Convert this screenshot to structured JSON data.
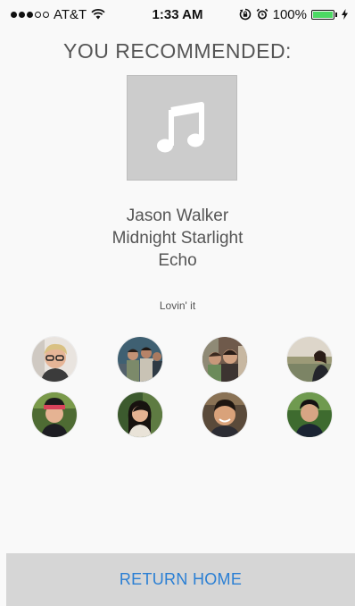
{
  "status_bar": {
    "carrier": "AT&T",
    "time": "1:33 AM",
    "battery_percent": "100%",
    "battery_level": 1.0,
    "signal_bars_filled": 3,
    "signal_bars_total": 5,
    "icons": [
      "wifi-icon",
      "rotation-lock-icon",
      "alarm-icon",
      "battery-icon",
      "charging-bolt-icon"
    ]
  },
  "header": {
    "title": "YOU RECOMMENDED:"
  },
  "album": {
    "icon": "music-note-icon"
  },
  "track": {
    "artist": "Jason Walker",
    "title": "Midnight Starlight",
    "album": "Echo"
  },
  "caption": "Lovin' it",
  "friends": [
    {
      "name": "friend-1"
    },
    {
      "name": "friend-2"
    },
    {
      "name": "friend-3"
    },
    {
      "name": "friend-4"
    },
    {
      "name": "friend-5"
    },
    {
      "name": "friend-6"
    },
    {
      "name": "friend-7"
    },
    {
      "name": "friend-8"
    }
  ],
  "footer": {
    "return_home_label": "RETURN HOME"
  },
  "colors": {
    "background": "#f9f9f9",
    "accent": "#2a7fd4",
    "button_bg": "#d6d6d6",
    "battery": "#4cd964"
  }
}
